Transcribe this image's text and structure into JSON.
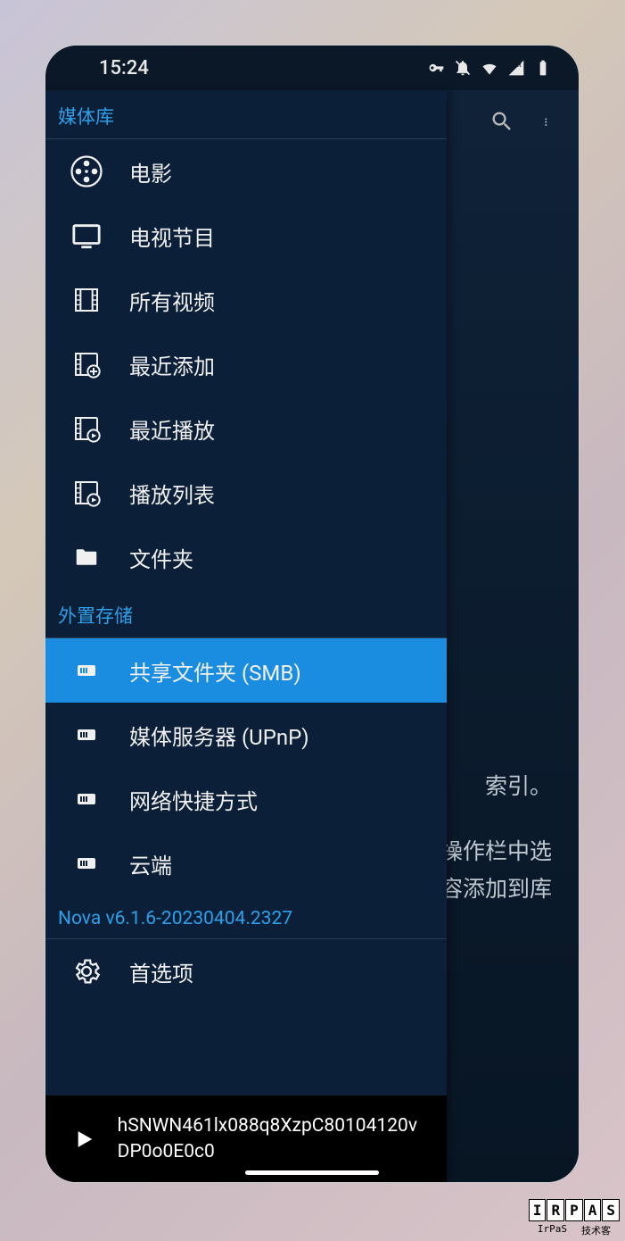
{
  "status": {
    "time": "15:24"
  },
  "behind": {
    "line1": "索引。",
    "line2": "操作栏中选",
    "line3": "容添加到库"
  },
  "drawer": {
    "section_media": "媒体库",
    "movies": "电影",
    "tv": "电视节目",
    "all_videos": "所有视频",
    "recent_add": "最近添加",
    "recent_play": "最近播放",
    "playlist": "播放列表",
    "folder": "文件夹",
    "section_ext": "外置存储",
    "smb": "共享文件夹 (SMB)",
    "upnp": "媒体服务器 (UPnP)",
    "shortcut": "网络快捷方式",
    "cloud": "云端",
    "section_version": "Nova v6.1.6-20230404.2327",
    "prefs": "首选项"
  },
  "now_playing": {
    "title": "hSNWN461lx088q8XzpC80104120vDP0o0E0c0"
  },
  "watermark": {
    "letters": [
      "I",
      "R",
      "P",
      "A",
      "S"
    ],
    "sub1": "IrPaS",
    "sub2": "技术客"
  }
}
